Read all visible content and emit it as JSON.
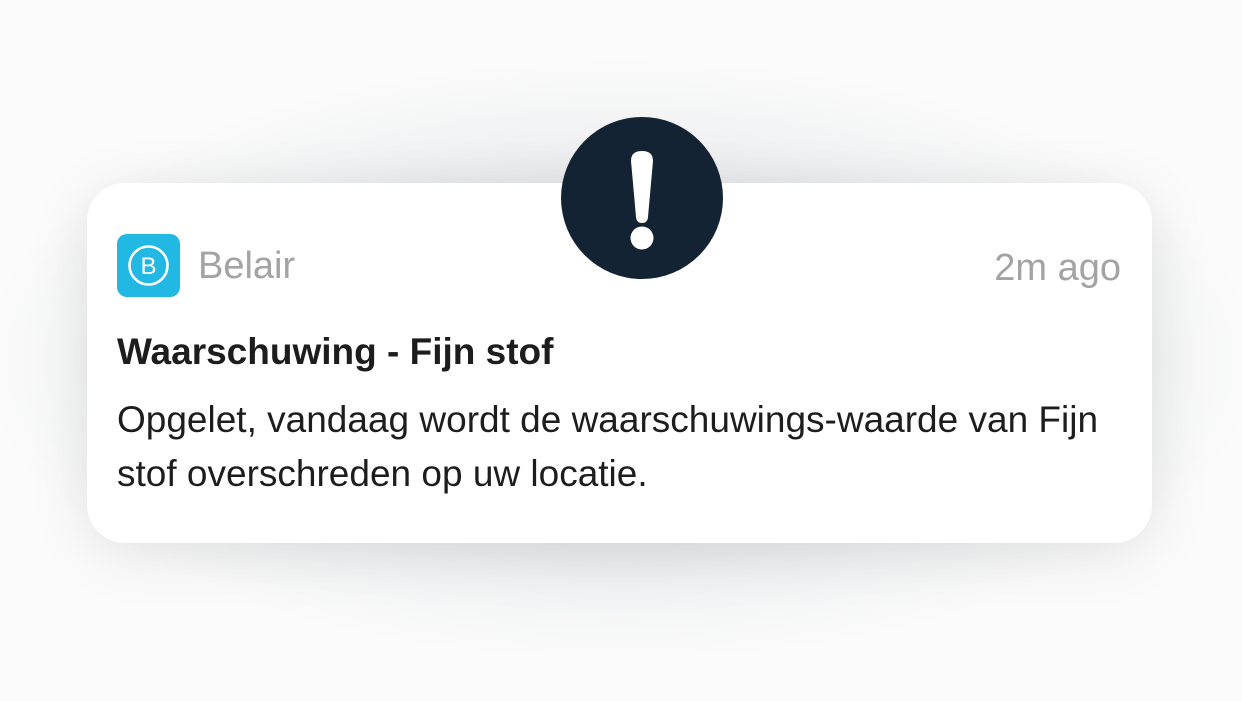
{
  "notification": {
    "app_icon": "belair-logo-icon",
    "app_icon_letter": "B",
    "app_name": "Belair",
    "timestamp": "2m ago",
    "title": "Waarschuwing - Fijn stof",
    "body": "Opgelet, vandaag wordt de waarschuwings-waarde van Fijn stof overschreden op uw locatie."
  },
  "alert_badge": {
    "icon": "exclamation-icon"
  },
  "colors": {
    "app_icon_bg": "#21b8e3",
    "badge_bg": "#142334",
    "secondary_text": "#a3a3a3",
    "primary_text": "#1d1d1d",
    "card_bg": "#ffffff"
  }
}
